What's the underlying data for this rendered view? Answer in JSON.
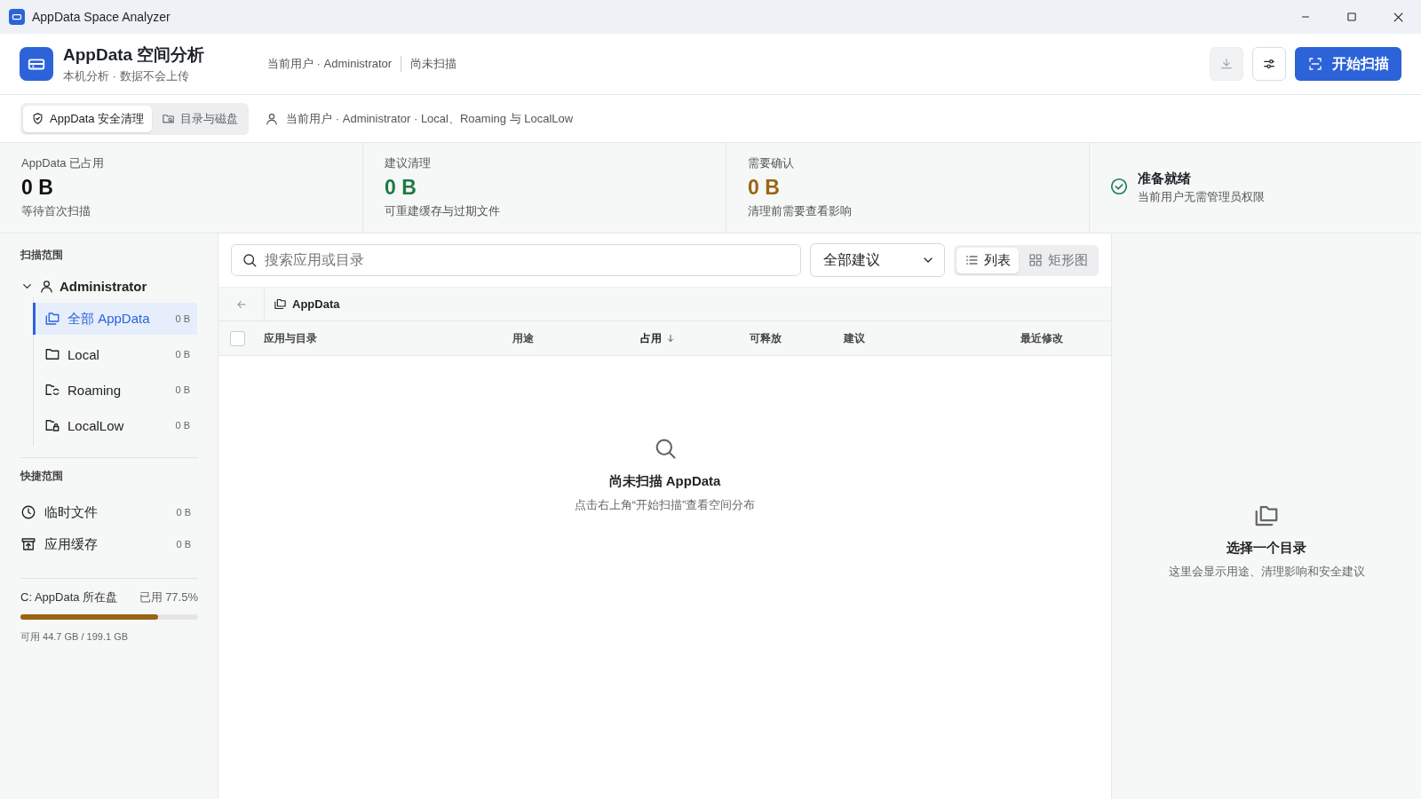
{
  "window": {
    "title": "AppData Space Analyzer"
  },
  "header": {
    "title": "AppData 空间分析",
    "subtitle": "本机分析 · 数据不会上传",
    "meta": [
      "当前用户 · Administrator",
      "尚未扫描"
    ],
    "buttons": [
      {
        "kind": "export",
        "disabled": true
      },
      {
        "kind": "settings",
        "disabled": false
      },
      {
        "kind": "scan",
        "label": "开始扫描",
        "disabled": false
      }
    ]
  },
  "tabs": [
    {
      "label": "AppData 安全清理",
      "selected": true
    },
    {
      "label": "目录与磁盘",
      "selected": false
    }
  ],
  "scope_text": "当前用户 · Administrator · Local、Roaming 与 LocalLow",
  "stats": [
    {
      "label": "AppData 已占用",
      "value": "0 B",
      "note": "等待首次扫描"
    },
    {
      "label": "建议清理",
      "value": "0 B",
      "note": "可重建缓存与过期文件"
    },
    {
      "label": "需要确认",
      "value": "0 B",
      "note": "清理前需要查看影响"
    }
  ],
  "status": {
    "title": "准备就绪",
    "note": "当前用户无需管理员权限"
  },
  "sidebar": {
    "scan_scope": {
      "heading": "扫描范围",
      "tree": [
        {
          "label": "Administrator",
          "expanded": true,
          "children": [
            {
              "label": "全部 AppData",
              "size": "0 B",
              "selected": true
            },
            {
              "label": "Local",
              "size": "0 B",
              "selected": false
            },
            {
              "label": "Roaming",
              "size": "0 B",
              "selected": false
            },
            {
              "label": "LocalLow",
              "size": "0 B",
              "selected": false
            }
          ]
        }
      ]
    },
    "quick_scope": {
      "heading": "快捷范围",
      "items": [
        {
          "label": "临时文件",
          "size": "0 B",
          "selected": false
        },
        {
          "label": "应用缓存",
          "size": "0 B",
          "selected": false
        }
      ]
    },
    "disk": {
      "label": "C: AppData 所在盘",
      "usage": "已用 77.5%",
      "level": 0.775,
      "note": "可用 44.7 GB / 199.1 GB"
    }
  },
  "main": {
    "search": {
      "placeholder": "搜索应用或目录"
    },
    "filter": {
      "value": "全部建议"
    },
    "views": [
      {
        "label": "列表",
        "selected": true
      },
      {
        "label": "矩形图",
        "selected": false
      }
    ],
    "breadcrumb": "AppData",
    "table": {
      "select_all": {
        "checked": false
      },
      "columns": [
        {
          "label": "应用与目录",
          "sorted": false
        },
        {
          "label": "用途",
          "sorted": false
        },
        {
          "label": "占用",
          "sorted": true
        },
        {
          "label": "可释放",
          "sorted": false
        },
        {
          "label": "建议",
          "sorted": false
        },
        {
          "label": "最近修改",
          "sorted": false
        }
      ]
    },
    "empty": {
      "title": "尚未扫描 AppData",
      "text": "点击右上角“开始扫描”查看空间分布"
    }
  },
  "detail": {
    "title": "选择一个目录",
    "text": "这里会显示用途、清理影响和安全建议"
  }
}
